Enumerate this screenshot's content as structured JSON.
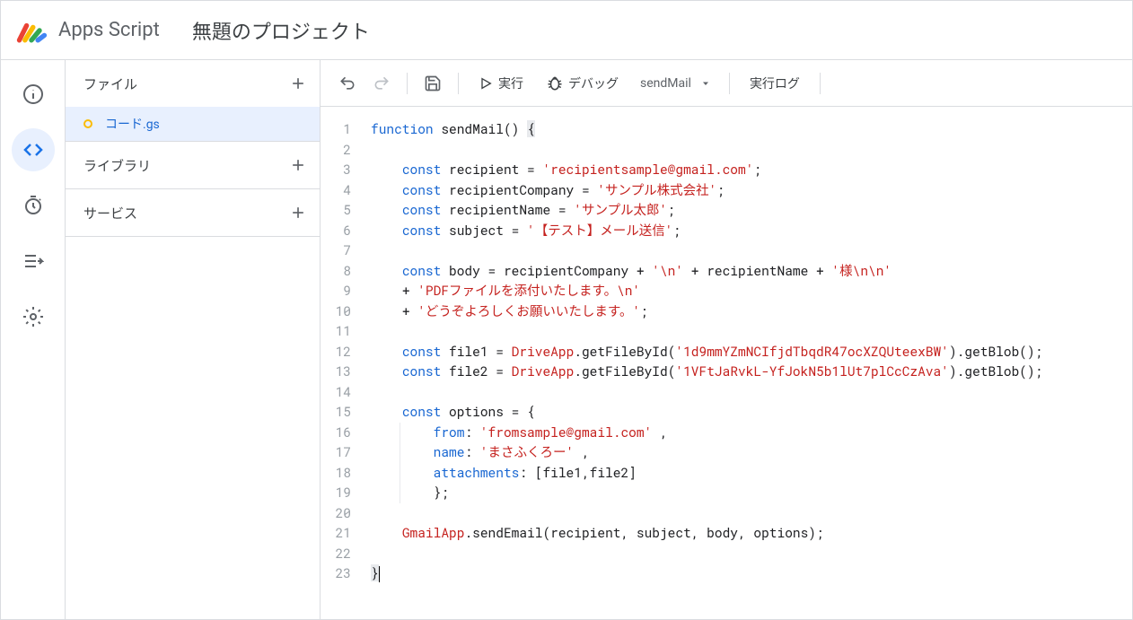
{
  "header": {
    "app_name": "Apps Script",
    "project_title": "無題のプロジェクト"
  },
  "sidebar": {
    "files_label": "ファイル",
    "libraries_label": "ライブラリ",
    "services_label": "サービス",
    "file_name": "コード.gs"
  },
  "toolbar": {
    "run": "実行",
    "debug": "デバッグ",
    "function_selected": "sendMail",
    "log": "実行ログ"
  },
  "code": {
    "lines": [
      {
        "n": 1,
        "tokens": [
          {
            "t": "function ",
            "c": "k"
          },
          {
            "t": "sendMail",
            "c": "fn"
          },
          {
            "t": "() ",
            "c": ""
          },
          {
            "t": "{",
            "c": "br"
          }
        ]
      },
      {
        "n": 2,
        "tokens": []
      },
      {
        "n": 3,
        "indent": 2,
        "tokens": [
          {
            "t": "const ",
            "c": "k"
          },
          {
            "t": "recipient = ",
            "c": ""
          },
          {
            "t": "'recipientsample@gmail.com'",
            "c": "s"
          },
          {
            "t": ";",
            "c": ""
          }
        ]
      },
      {
        "n": 4,
        "indent": 2,
        "tokens": [
          {
            "t": "const ",
            "c": "k"
          },
          {
            "t": "recipientCompany = ",
            "c": ""
          },
          {
            "t": "'サンプル株式会社'",
            "c": "s"
          },
          {
            "t": ";",
            "c": ""
          }
        ]
      },
      {
        "n": 5,
        "indent": 2,
        "tokens": [
          {
            "t": "const ",
            "c": "k"
          },
          {
            "t": "recipientName = ",
            "c": ""
          },
          {
            "t": "'サンプル太郎'",
            "c": "s"
          },
          {
            "t": ";",
            "c": ""
          }
        ]
      },
      {
        "n": 6,
        "indent": 2,
        "tokens": [
          {
            "t": "const ",
            "c": "k"
          },
          {
            "t": "subject = ",
            "c": ""
          },
          {
            "t": "'【テスト】メール送信'",
            "c": "s"
          },
          {
            "t": ";",
            "c": ""
          }
        ]
      },
      {
        "n": 7,
        "tokens": []
      },
      {
        "n": 8,
        "indent": 2,
        "tokens": [
          {
            "t": "const ",
            "c": "k"
          },
          {
            "t": "body = recipientCompany + ",
            "c": ""
          },
          {
            "t": "'\\n'",
            "c": "s"
          },
          {
            "t": " + recipientName + ",
            "c": ""
          },
          {
            "t": "'様\\n\\n'",
            "c": "s"
          }
        ]
      },
      {
        "n": 9,
        "indent": 2,
        "tokens": [
          {
            "t": "+ ",
            "c": ""
          },
          {
            "t": "'PDFファイルを添付いたします。\\n'",
            "c": "s"
          }
        ]
      },
      {
        "n": 10,
        "indent": 2,
        "tokens": [
          {
            "t": "+ ",
            "c": ""
          },
          {
            "t": "'どうぞよろしくお願いいたします。'",
            "c": "s"
          },
          {
            "t": ";",
            "c": ""
          }
        ]
      },
      {
        "n": 11,
        "tokens": []
      },
      {
        "n": 12,
        "indent": 2,
        "tokens": [
          {
            "t": "const ",
            "c": "k"
          },
          {
            "t": "file1 = ",
            "c": ""
          },
          {
            "t": "DriveApp",
            "c": "ident"
          },
          {
            "t": ".getFileById(",
            "c": ""
          },
          {
            "t": "'1d9mmYZmNCIfjdTbqdR47ocXZQUteexBW'",
            "c": "s"
          },
          {
            "t": ").getBlob();",
            "c": ""
          }
        ]
      },
      {
        "n": 13,
        "indent": 2,
        "tokens": [
          {
            "t": "const ",
            "c": "k"
          },
          {
            "t": "file2 = ",
            "c": ""
          },
          {
            "t": "DriveApp",
            "c": "ident"
          },
          {
            "t": ".getFileById(",
            "c": ""
          },
          {
            "t": "'1VFtJaRvkL-YfJokN5b1lUt7plCcCzAva'",
            "c": "s"
          },
          {
            "t": ").getBlob();",
            "c": ""
          }
        ]
      },
      {
        "n": 14,
        "tokens": []
      },
      {
        "n": 15,
        "indent": 2,
        "tokens": [
          {
            "t": "const ",
            "c": "k"
          },
          {
            "t": "options = {",
            "c": ""
          }
        ]
      },
      {
        "n": 16,
        "indent": 4,
        "guide": true,
        "tokens": [
          {
            "t": "from",
            "c": "p"
          },
          {
            "t": ": ",
            "c": ""
          },
          {
            "t": "'fromsample@gmail.com'",
            "c": "s"
          },
          {
            "t": " ,",
            "c": ""
          }
        ]
      },
      {
        "n": 17,
        "indent": 4,
        "guide": true,
        "tokens": [
          {
            "t": "name",
            "c": "p"
          },
          {
            "t": ": ",
            "c": ""
          },
          {
            "t": "'まさふくろー'",
            "c": "s"
          },
          {
            "t": " ,",
            "c": ""
          }
        ]
      },
      {
        "n": 18,
        "indent": 4,
        "guide": true,
        "tokens": [
          {
            "t": "attachments",
            "c": "p"
          },
          {
            "t": ": [file1,file2]",
            "c": ""
          }
        ]
      },
      {
        "n": 19,
        "indent": 4,
        "guide": true,
        "tokens": [
          {
            "t": "};",
            "c": ""
          }
        ]
      },
      {
        "n": 20,
        "tokens": []
      },
      {
        "n": 21,
        "indent": 2,
        "tokens": [
          {
            "t": "GmailApp",
            "c": "ident"
          },
          {
            "t": ".sendEmail(recipient, subject, body, options);",
            "c": ""
          }
        ]
      },
      {
        "n": 22,
        "tokens": []
      },
      {
        "n": 23,
        "tokens": [
          {
            "t": "}",
            "c": "br"
          }
        ],
        "cursor": true
      }
    ]
  }
}
